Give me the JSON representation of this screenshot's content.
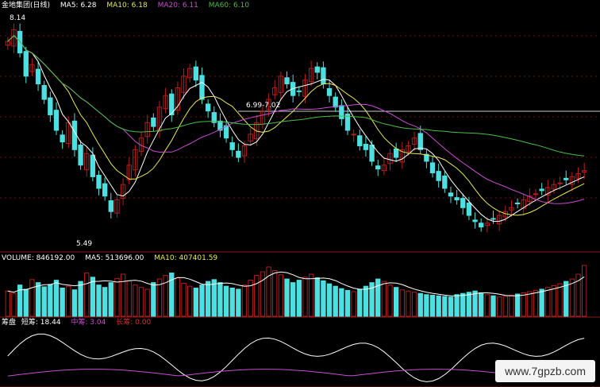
{
  "colors": {
    "up": "#b81e1e",
    "down": "#4ee0e0",
    "ma5": "#ffffff",
    "ma10": "#e8e85a",
    "ma20": "#c84fcf",
    "ma60": "#4bbd4b",
    "panel_line": "#8b1a1a",
    "zhongpan": "#c84fcf",
    "changpan": "#d83030"
  },
  "header": {
    "title": "金地集团(日线)",
    "ma5_label": "MA5: 6.28",
    "ma10_label": "MA10: 6.18",
    "ma20_label": "MA20: 6.11",
    "ma60_label": "MA60: 6.10"
  },
  "annotations": {
    "high": "8.14",
    "low": "5.49",
    "range_label": "6.99-7.02"
  },
  "volume_header": {
    "volume_label": "VOLUME: 846192.00",
    "ma5_label": "MA5: 513696.00",
    "ma10_label": "MA10: 407401.59"
  },
  "indicator_header": {
    "name": "筹盘",
    "short_label": "短筹: 18.44",
    "mid_label": "中筹: 3.04",
    "long_label": "长筹: 0.00"
  },
  "watermark": "www.7gpzb.com",
  "chart_data": [
    {
      "type": "candlestick",
      "title": "金地集团(日线)",
      "ylim": [
        5.3,
        8.3
      ],
      "series": [
        {
          "name": "MA5",
          "value": 6.28
        },
        {
          "name": "MA10",
          "value": 6.18
        },
        {
          "name": "MA20",
          "value": 6.11
        },
        {
          "name": "MA60",
          "value": 6.1
        }
      ],
      "annotations": [
        "8.14",
        "5.49",
        "6.99-7.02"
      ],
      "close": [
        7.95,
        8.1,
        7.8,
        7.5,
        7.65,
        7.4,
        7.2,
        7.0,
        6.8,
        6.65,
        6.9,
        6.55,
        6.35,
        6.5,
        6.2,
        6.05,
        5.95,
        5.75,
        5.9,
        6.1,
        6.35,
        6.55,
        6.7,
        6.9,
        6.85,
        7.1,
        7.25,
        7.0,
        7.35,
        7.5,
        7.6,
        7.45,
        7.2,
        7.05,
        6.9,
        6.8,
        6.7,
        6.55,
        6.45,
        6.6,
        6.75,
        6.9,
        7.05,
        7.2,
        7.35,
        7.5,
        7.4,
        7.25,
        7.3,
        7.45,
        7.6,
        7.55,
        7.4,
        7.25,
        7.1,
        6.95,
        6.8,
        6.75,
        6.6,
        6.55,
        6.4,
        6.3,
        6.35,
        6.5,
        6.45,
        6.55,
        6.6,
        6.7,
        6.55,
        6.4,
        6.25,
        6.15,
        6.05,
        5.95,
        5.9,
        5.8,
        5.7,
        5.62,
        5.55,
        5.6,
        5.65,
        5.7,
        5.75,
        5.8,
        5.85,
        5.9,
        5.95,
        5.98,
        6.02,
        6.06,
        6.1,
        6.12,
        6.16,
        6.2,
        6.24,
        6.28
      ]
    },
    {
      "type": "bar",
      "title": "VOLUME",
      "series": [
        {
          "name": "VOLUME",
          "value": 846192.0
        },
        {
          "name": "MA5",
          "value": 513696.0
        },
        {
          "name": "MA10",
          "value": 407401.59
        }
      ],
      "values": [
        420000,
        380000,
        520000,
        450000,
        610000,
        560000,
        490000,
        530000,
        600000,
        470000,
        500000,
        440000,
        580000,
        720000,
        650000,
        520000,
        480000,
        560000,
        630000,
        700000,
        590000,
        520000,
        480000,
        450000,
        560000,
        620000,
        680000,
        720000,
        640000,
        550000,
        500000,
        470000,
        520000,
        580000,
        610000,
        560000,
        500000,
        470000,
        450000,
        520000,
        600000,
        680000,
        740000,
        820000,
        760000,
        690000,
        620000,
        560000,
        600000,
        650000,
        700000,
        640000,
        590000,
        540000,
        500000,
        460000,
        430000,
        410000,
        450000,
        500000,
        560000,
        620000,
        580000,
        520000,
        480000,
        440000,
        420000,
        400000,
        380000,
        360000,
        350000,
        340000,
        330000,
        320000,
        360000,
        380000,
        400000,
        420000,
        390000,
        360000,
        340000,
        320000,
        330000,
        350000,
        370000,
        390000,
        410000,
        430000,
        450000,
        480000,
        510000,
        540000,
        580000,
        620000,
        700000,
        846192
      ]
    },
    {
      "type": "line",
      "title": "筹盘",
      "series": [
        {
          "name": "短筹",
          "value": 18.44
        },
        {
          "name": "中筹",
          "value": 3.04
        },
        {
          "name": "长筹",
          "value": 0.0
        }
      ]
    }
  ]
}
